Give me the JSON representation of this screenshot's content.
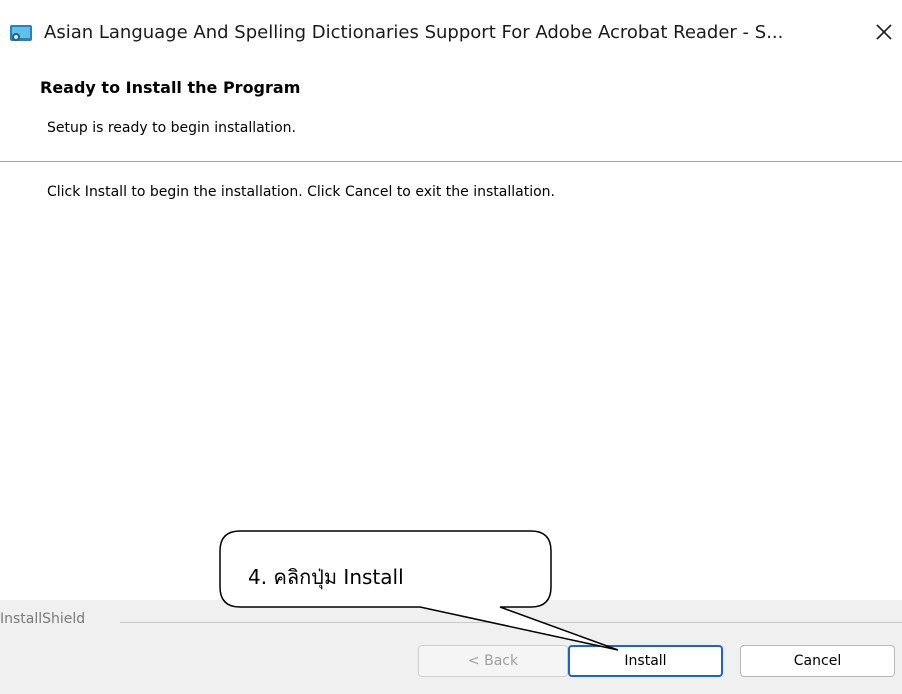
{
  "window": {
    "title": "Asian Language And Spelling Dictionaries Support For Adobe Acrobat Reader - S...",
    "icon": "installer-icon",
    "close_icon": "close-icon"
  },
  "header": {
    "title": "Ready to Install the Program",
    "subtitle": "Setup is ready to begin installation."
  },
  "main": {
    "instruction": "Click Install to begin the installation. Click Cancel to exit the installation."
  },
  "footer": {
    "brand": "InstallShield",
    "back_label": "< Back",
    "install_label": "Install",
    "cancel_label": "Cancel"
  },
  "annotation": {
    "text": "4. คลิกปุ่ม Install"
  },
  "colors": {
    "accent": "#1f62c8",
    "divider": "#a0a0a0",
    "footer_bg": "#f0f0f0"
  }
}
